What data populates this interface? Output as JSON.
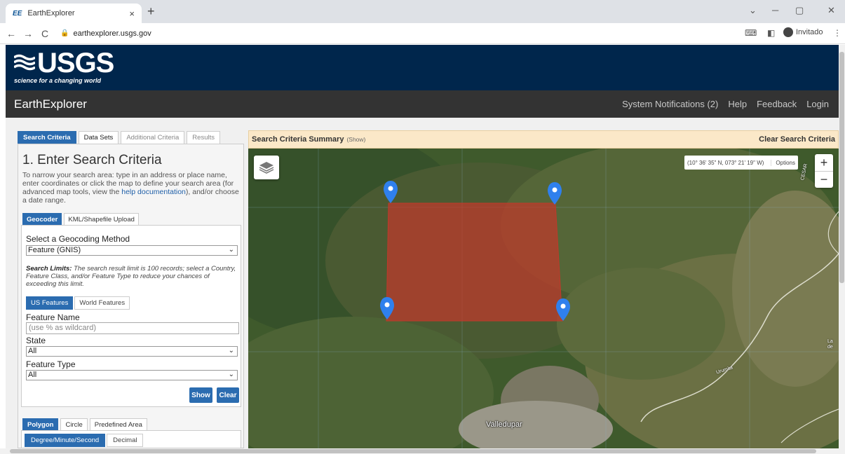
{
  "browser": {
    "tab_favicon": "EE",
    "tab_title": "EarthExplorer",
    "tab_close": "×",
    "new_tab": "+",
    "url": "earthexplorer.usgs.gov",
    "profile_label": "Invitado",
    "win_min": "─",
    "win_max": "▢",
    "win_close": "✕",
    "menu": "⋮",
    "back": "←",
    "forward": "→",
    "reload": "C"
  },
  "site": {
    "logo_text": "USGS",
    "logo_tagline": "science for a changing world",
    "app_title": "EarthExplorer",
    "nav": [
      "System Notifications (2)",
      "Help",
      "Feedback",
      "Login"
    ]
  },
  "left_panel": {
    "tabs": [
      "Search Criteria",
      "Data Sets",
      "Additional Criteria",
      "Results"
    ],
    "heading": "1. Enter Search Criteria",
    "desc_pre": "To narrow your search area: type in an address or place name, enter coordinates or click the map to define your search area (for advanced map tools, view the ",
    "desc_link": "help documentation",
    "desc_post": "), and/or choose a date range.",
    "sub_tabs": [
      "Geocoder",
      "KML/Shapefile Upload"
    ],
    "geocode_label": "Select a Geocoding Method",
    "geocode_value": "Feature (GNIS)",
    "limits_bold": "Search Limits:",
    "limits_text": " The search result limit is 100 records; select a Country, Feature Class, and/or Feature Type to reduce your chances of exceeding this limit.",
    "feature_tabs": [
      "US Features",
      "World Features"
    ],
    "feature_name_label": "Feature Name",
    "feature_name_placeholder": "(use % as wildcard)",
    "state_label": "State",
    "state_value": "All",
    "feature_type_label": "Feature Type",
    "feature_type_value": "All",
    "show_button": "Show",
    "clear_button": "Clear",
    "polygon_tabs": [
      "Polygon",
      "Circle",
      "Predefined Area"
    ],
    "coord_tabs": [
      "Degree/Minute/Second",
      "Decimal"
    ]
  },
  "map": {
    "summary_title": "Search Criteria Summary",
    "summary_show": "(Show)",
    "clear_label": "Clear Search Criteria",
    "coord_readout": "(10° 36' 35\" N, 073° 21' 19\" W)",
    "options_label": "Options",
    "zoom_in": "+",
    "zoom_out": "−",
    "city_label": "Valledupar",
    "river_label": "Urumita",
    "edge_label_1": "La",
    "edge_label_2": "de",
    "edge_label_3": "CESAR",
    "polygon_color": "#c0392b",
    "marker_color": "#2f80ed"
  }
}
